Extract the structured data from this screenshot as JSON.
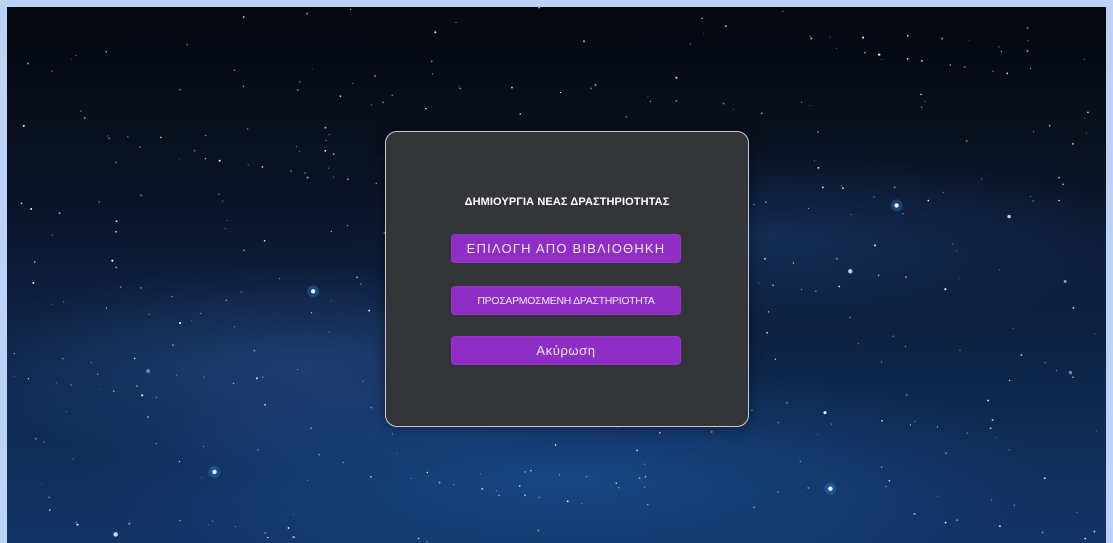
{
  "dialog": {
    "title": "ΔΗΜΙΟΥΡΓΙΑ ΝΕΑΣ ΔΡΑΣΤΗΡΙΟΤΗΤΑΣ",
    "buttons": {
      "library": "ΕΠΙΛΟΓΗ ΑΠΟ ΒΙΒΛΙΟΘΗΚΗ",
      "custom": "ΠΡΟΣΑΡΜΟΣΜΕΝΗ ΔΡΑΣΤΗΡΙΟΤΗΤΑ",
      "cancel": "Ακύρωση"
    }
  },
  "colors": {
    "frame": "#bcd3f7",
    "dialog_bg": "#343538",
    "dialog_border": "#c9c9cd",
    "button_bg": "#8e2ec4",
    "button_text": "#f2e8fb",
    "title_text": "#ffffff"
  }
}
